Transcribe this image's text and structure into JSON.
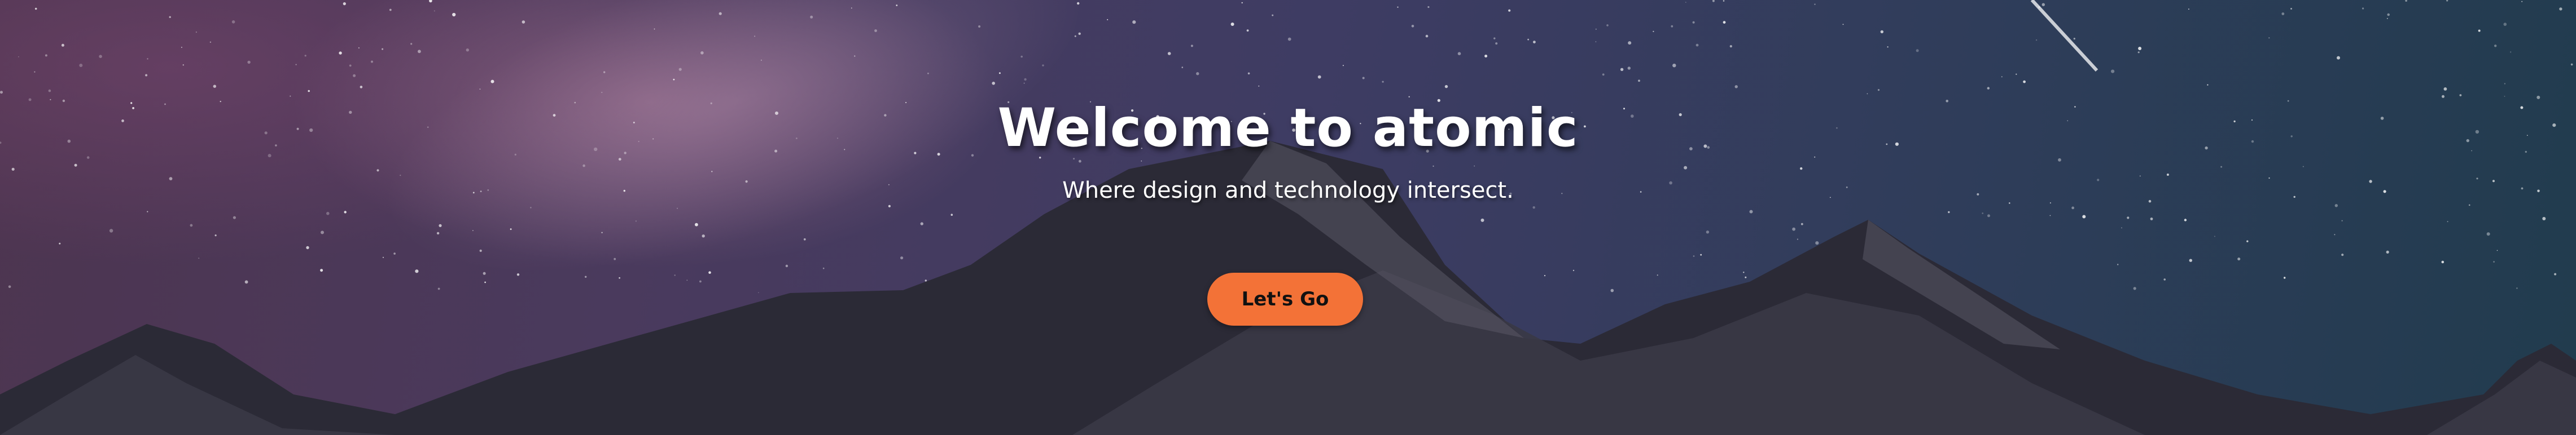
{
  "hero": {
    "title": "Welcome to atomic",
    "subtitle": "Where design and technology intersect.",
    "cta_label": "Let's Go"
  },
  "colors": {
    "cta_background": "#f37237",
    "cta_text": "#111111",
    "heading_text": "#ffffff",
    "sky_left": "#4d3550",
    "sky_right": "#213c4e",
    "mountain": "#2b2a36"
  },
  "background": {
    "image_icon": "starry-mountain-night-sky-image"
  }
}
